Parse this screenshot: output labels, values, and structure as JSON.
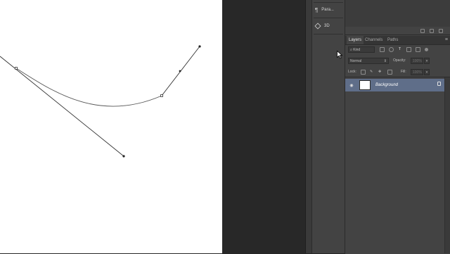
{
  "dock": {
    "items": [
      {
        "label": "Para...",
        "icon": "paragraph-icon"
      },
      {
        "label": "3D",
        "icon": "3d-cube-icon"
      }
    ]
  },
  "layers_panel": {
    "tabs": [
      "Layers",
      "Channels",
      "Paths"
    ],
    "active_tab": "Layers",
    "filter_kind": "Kind",
    "blend_mode": "Normal",
    "opacity_label": "Opacity:",
    "opacity_value": "100%",
    "lock_label": "Lock:",
    "fill_label": "Fill:",
    "fill_value": "100%",
    "layers": [
      {
        "name": "Background",
        "locked": true,
        "visible": true,
        "selected": true
      }
    ]
  },
  "colors": {
    "canvas": "#ffffff",
    "panel": "#434343",
    "pasteboard": "#282828",
    "selection": "#5f6e89",
    "path_stroke": "#555555"
  }
}
